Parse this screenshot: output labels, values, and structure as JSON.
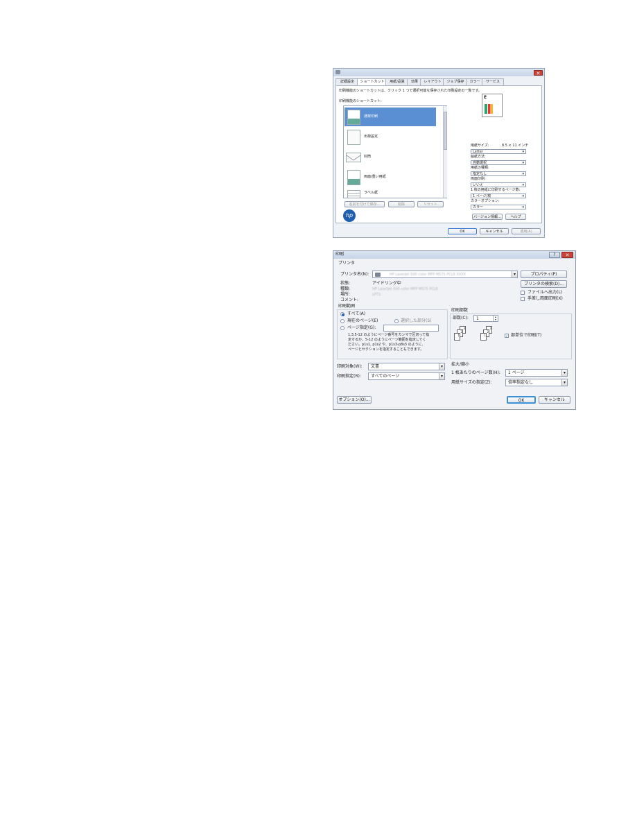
{
  "dialog1": {
    "tabs": [
      "詳細設定",
      "ショートカット",
      "用紙/品質",
      "効果",
      "レイアウト",
      "ジョブ保存",
      "カラー",
      "サービス"
    ],
    "description": "印刷機能のショートカットは、クリック 1 つで選択可能な保存された印刷設定の一覧です。",
    "list_label": "印刷機能のショートカット:",
    "shortcuts": [
      "通常印刷",
      "出荷設定",
      "封筒",
      "両面/重い用紙",
      "ラベル紙"
    ],
    "buttons_row": [
      "名前を付けて保存...",
      "削除",
      "リセット"
    ],
    "paper_size_label": "用紙サイズ:",
    "paper_size_value": "8.5 × 11 インチ",
    "fields": [
      {
        "label": "Letter",
        "value": ""
      },
      {
        "label": "給紙方法:",
        "value": "自動選択"
      },
      {
        "label": "用紙の種類:",
        "value": "指定なし"
      },
      {
        "label": "両面印刷:",
        "value": "いいえ"
      },
      {
        "label": "1 枚の用紙に印刷するページ数:",
        "value": "1 ページ/枚"
      },
      {
        "label": "カラーオプション:",
        "value": "カラー"
      }
    ],
    "about_button": "バージョン情報...",
    "help_button": "ヘルプ",
    "ok_button": "OK",
    "cancel_button": "キャンセル",
    "apply_button": "適用(A)"
  },
  "dialog2": {
    "title": "印刷",
    "printer_section": "プリンタ",
    "printer_name_label": "プリンタ名(N):",
    "printer_name_value": "HP LaserJet 500 color MFP M575 PCL6 XXXX",
    "properties_button": "プロパティ(P)",
    "status_label": "状態:",
    "status_value": "アイドリング中",
    "type_label": "種類:",
    "type_value": "HP LaserJet 500 color MFP M575 PCL6",
    "location_label": "場所:",
    "location_value": "LPT1:",
    "comment_label": "コメント:",
    "find_printer_button": "プリンタの検索(D)...",
    "print_to_file": "ファイルへ出力(L)",
    "manual_duplex": "手差し両面印刷(X)",
    "range_title": "印刷範囲",
    "range_all": "すべて(A)",
    "range_current": "現在のページ(E)",
    "range_selection": "選択した部分(S)",
    "range_pages": "ページ指定(G):",
    "range_help": [
      "1,3,5-12 のようにページ番号をカンマで区切って指",
      "定するか、5-12 のようにページ範囲を指定してく",
      "ださい。p1s1, p1s2 や、p1s3-p8s3 のように、",
      "ページとセクションを指定することもできます。"
    ],
    "copies_title": "印刷部数",
    "copies_label": "部数(C):",
    "copies_value": "1",
    "collate_label": "部単位で印刷(T)",
    "print_what_label": "印刷対象(W):",
    "print_what_value": "文書",
    "print_label": "印刷指定(R):",
    "print_value": "すべてのページ",
    "zoom_title": "拡大/縮小",
    "pages_per_sheet_label": "1 枚あたりのページ数(H):",
    "pages_per_sheet_value": "1 ページ",
    "scale_label": "用紙サイズの指定(Z):",
    "scale_value": "倍率指定なし",
    "options_button": "オプション(O)...",
    "ok_button": "OK",
    "cancel_button": "キャンセル"
  }
}
